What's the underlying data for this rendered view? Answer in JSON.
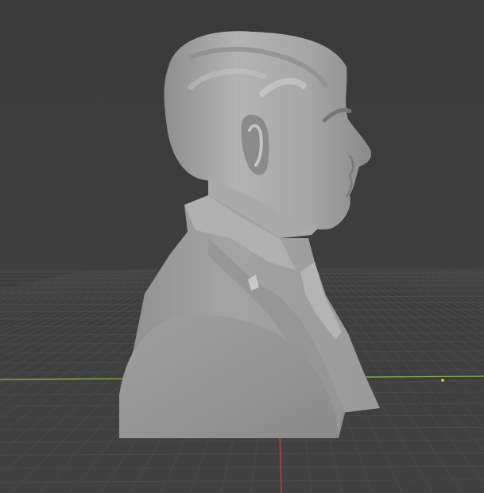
{
  "viewport": {
    "background_color": "#3d3d3d",
    "grid_color": "#4a4a4a",
    "x_axis_color": "#8fbf3a",
    "y_axis_color": "#c23b3b",
    "object": {
      "name": "bust-sculpture",
      "color": "#a0a0a0",
      "highlight_color": "#b8b8b8",
      "shadow_color": "#7a7a7a"
    },
    "cursor": {
      "name": "3d-cursor-icon",
      "color": "#f2d24a"
    }
  }
}
